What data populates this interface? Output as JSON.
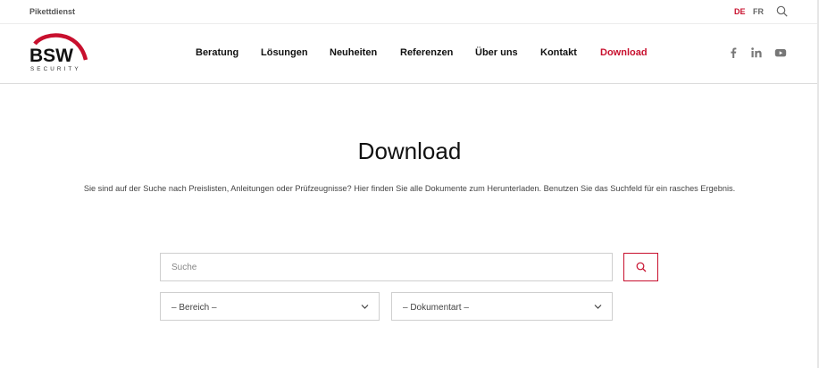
{
  "topbar": {
    "piket_label": "Pikettdienst",
    "lang_de": "DE",
    "lang_fr": "FR"
  },
  "brand": {
    "logo_word": "BSW",
    "logo_sub": "SECURITY"
  },
  "nav": {
    "items": [
      {
        "label": "Beratung"
      },
      {
        "label": "Lösungen"
      },
      {
        "label": "Neuheiten"
      },
      {
        "label": "Referenzen"
      },
      {
        "label": "Über uns"
      },
      {
        "label": "Kontakt"
      },
      {
        "label": "Download"
      }
    ]
  },
  "social": [
    "facebook-icon",
    "linkedin-icon",
    "youtube-icon"
  ],
  "main": {
    "title": "Download",
    "intro": "Sie sind auf der Suche nach Preislisten, Anleitungen oder Prüfzeugnisse? Hier finden Sie alle Dokumente zum Herunterladen. Benutzen Sie das Suchfeld für ein rasches Ergebnis."
  },
  "search": {
    "placeholder": "Suche",
    "value": ""
  },
  "filters": {
    "bereich": "– Bereich –",
    "dokumentart": "– Dokumentart –"
  },
  "colors": {
    "accent": "#c8102e",
    "text": "#111111",
    "border": "#cfcfcf"
  }
}
